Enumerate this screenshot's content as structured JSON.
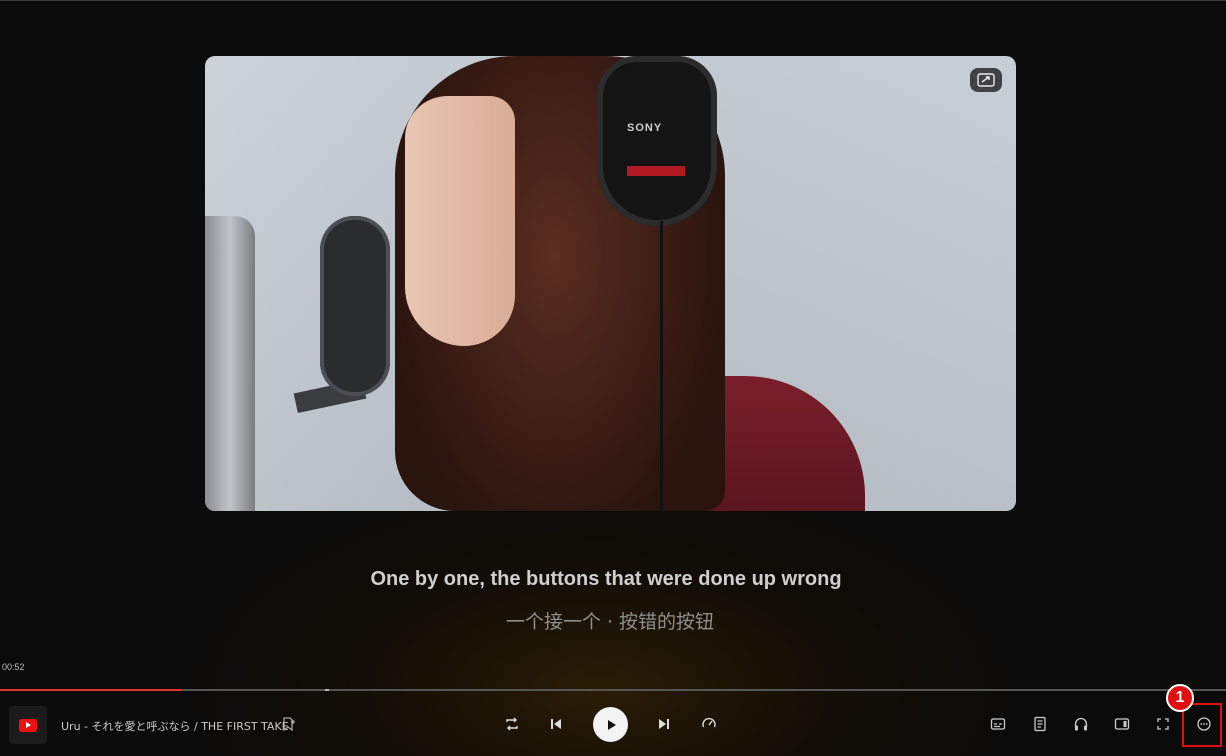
{
  "lyrics": {
    "current_line": "One by one, the buttons that were done up wrong",
    "translation": "一个接一个 · 按错的按钮"
  },
  "video": {
    "headphone_brand": "SONY"
  },
  "player": {
    "elapsed_time": "00:52",
    "progress": 0.148,
    "track_title": "Uru - それを愛と呼ぶなら / THE FIRST TAKE",
    "source_icon": "youtube-icon"
  },
  "annotation": {
    "badge_number": "1",
    "highlight_color": "#e01010"
  },
  "colors": {
    "progress_accent": "#e0342f",
    "background": "#0b0b0b"
  }
}
